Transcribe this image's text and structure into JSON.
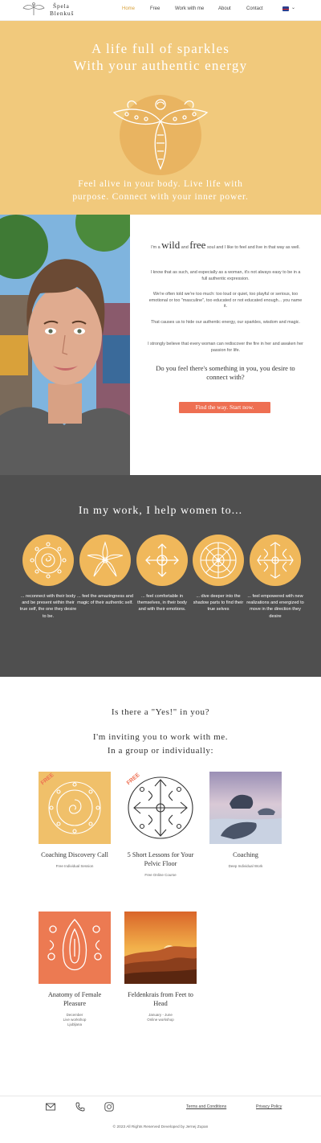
{
  "nav": {
    "logo_line1": "Špela",
    "logo_line2": "Blenkuš",
    "items": [
      "Home",
      "Free",
      "Work with me",
      "About",
      "Contact"
    ]
  },
  "hero": {
    "title_line1": "A life full of sparkles",
    "title_line2": "With your authentic energy",
    "subtitle_line1": "Feel alive in your body. Live life with",
    "subtitle_line2": "purpose. Connect with your inner power."
  },
  "about": {
    "intro_pre": "I'm a",
    "wild": "wild",
    "and": "and",
    "free": "free",
    "intro_post": "soul and I like to feel and live in that way as well.",
    "p1": "I know that as such, and especially as a woman, it's not always easy to be in a full authentic expression.",
    "p2": "We're often told we're too much: too loud or quiet, too playful or serious, too emotional or too \"masculine\", too educated or not educated enough... you name it.",
    "p3": "That causes us to hide our authentic energy, our sparkles, wisdom and magic.",
    "p4": "I strongly believe that every woman can rediscover the fire in her and awaken her passion for life.",
    "question": "Do you feel there's something in you, you desire to connect with?",
    "cta": "Find the way. Start now."
  },
  "help": {
    "title": "In my work, I help women to...",
    "items": [
      "... reconnect with their body and be present within their true self, the one they desire to be.",
      "... feel the amazingness and magic of their authentic self.",
      "... feel comfortable in themselves, in their body and with their emotions.",
      "... dive deeper into the shadow parts to find their true selves",
      "... feel empowered with new realizations and energized to move in the direction they desire"
    ]
  },
  "invite": {
    "yes": "Is there a \"Yes!\" in you?",
    "line1": "I'm inviting you to work with me.",
    "line2": "In a group or individually:"
  },
  "offers": [
    {
      "badge": "FREE",
      "title": "Coaching Discovery Call",
      "sub": "Free Individual Session"
    },
    {
      "badge": "FREE",
      "title": "5 Short Lessons for Your Pelvic Floor",
      "sub": "Free Online Course"
    },
    {
      "badge": "",
      "title": "Coaching",
      "sub": "Deep Individual Work"
    },
    {
      "badge": "",
      "title": "Anatomy of Female Pleasure",
      "sub1": "December",
      "sub2": "Live workshop",
      "sub3": "Ljubljana"
    },
    {
      "badge": "",
      "title": "Feldenkrais from Feet to Head",
      "sub1": "January - June",
      "sub2": "Online workshop"
    }
  ],
  "footer": {
    "terms": "Terms and Conditions",
    "privacy": "Privacy Policy",
    "copyright": "© 2023 All Rights Reserved Developed by Jernej Zupan"
  },
  "colors": {
    "accent": "#f1c97c",
    "cta": "#ee6f52",
    "dark": "#4f4f4f"
  }
}
